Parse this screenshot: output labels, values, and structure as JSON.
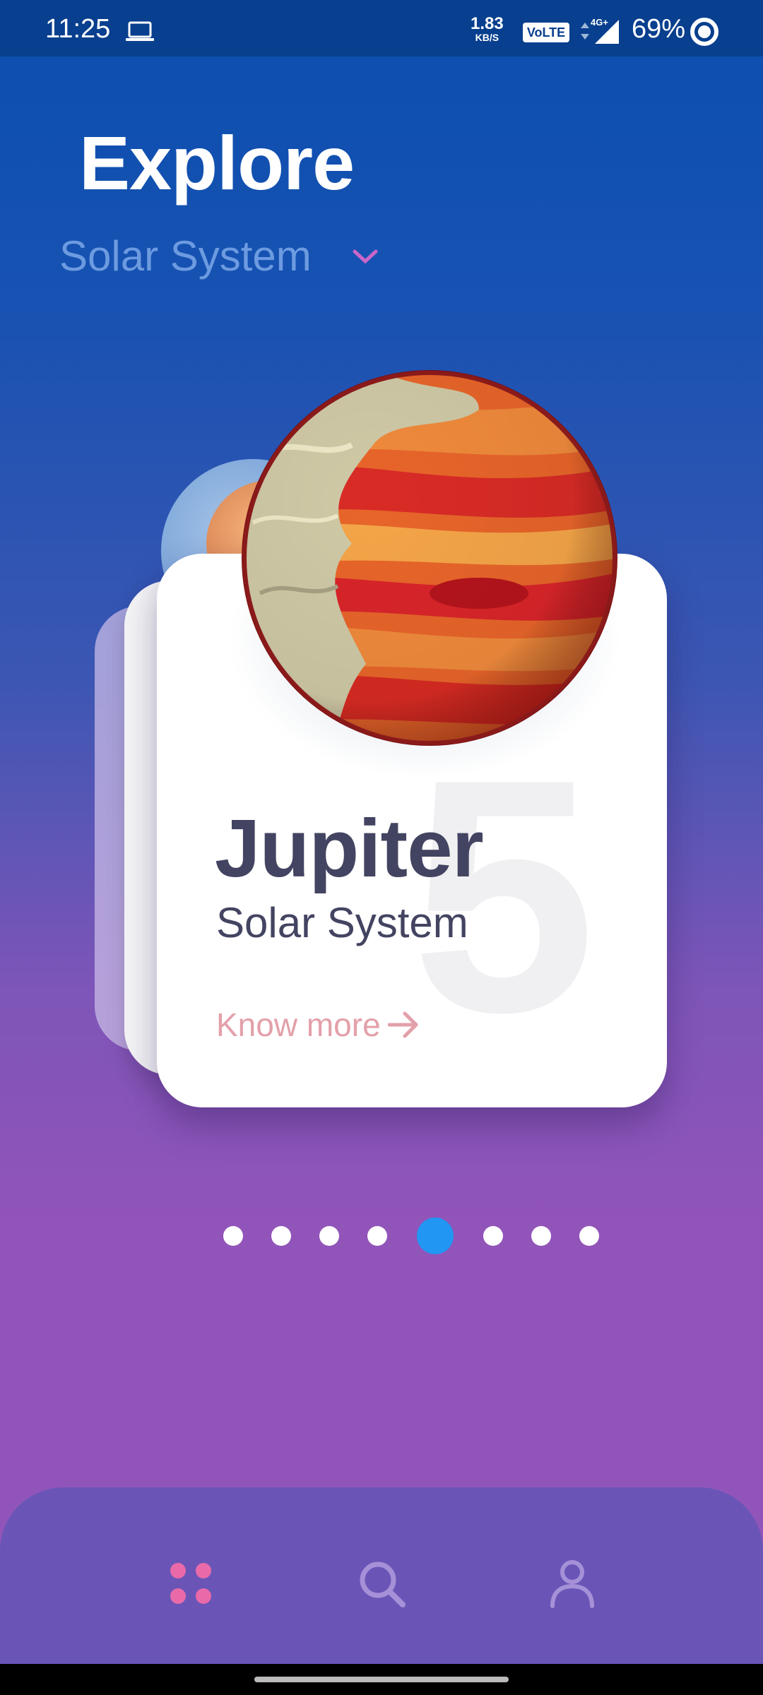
{
  "status_bar": {
    "time": "11:25",
    "speed_value": "1.83",
    "speed_unit": "KB/S",
    "volte": "VoLTE",
    "network": "4G+",
    "battery": "69%"
  },
  "header": {
    "title": "Explore",
    "category": "Solar System"
  },
  "card": {
    "planet_name": "Jupiter",
    "planet_category": "Solar System",
    "position_number": "5",
    "cta_label": "Know more"
  },
  "pagination": {
    "total": 8,
    "active_index": 4
  },
  "bottom_nav": {
    "items": [
      {
        "icon": "grid-icon",
        "active": true
      },
      {
        "icon": "search-icon",
        "active": false
      },
      {
        "icon": "user-icon",
        "active": false
      }
    ]
  },
  "colors": {
    "active_accent": "#e96aa8",
    "inactive_nav": "#a691d8",
    "active_dot": "#2196f3",
    "card_text": "#434461",
    "cta": "#e3a0aa"
  }
}
